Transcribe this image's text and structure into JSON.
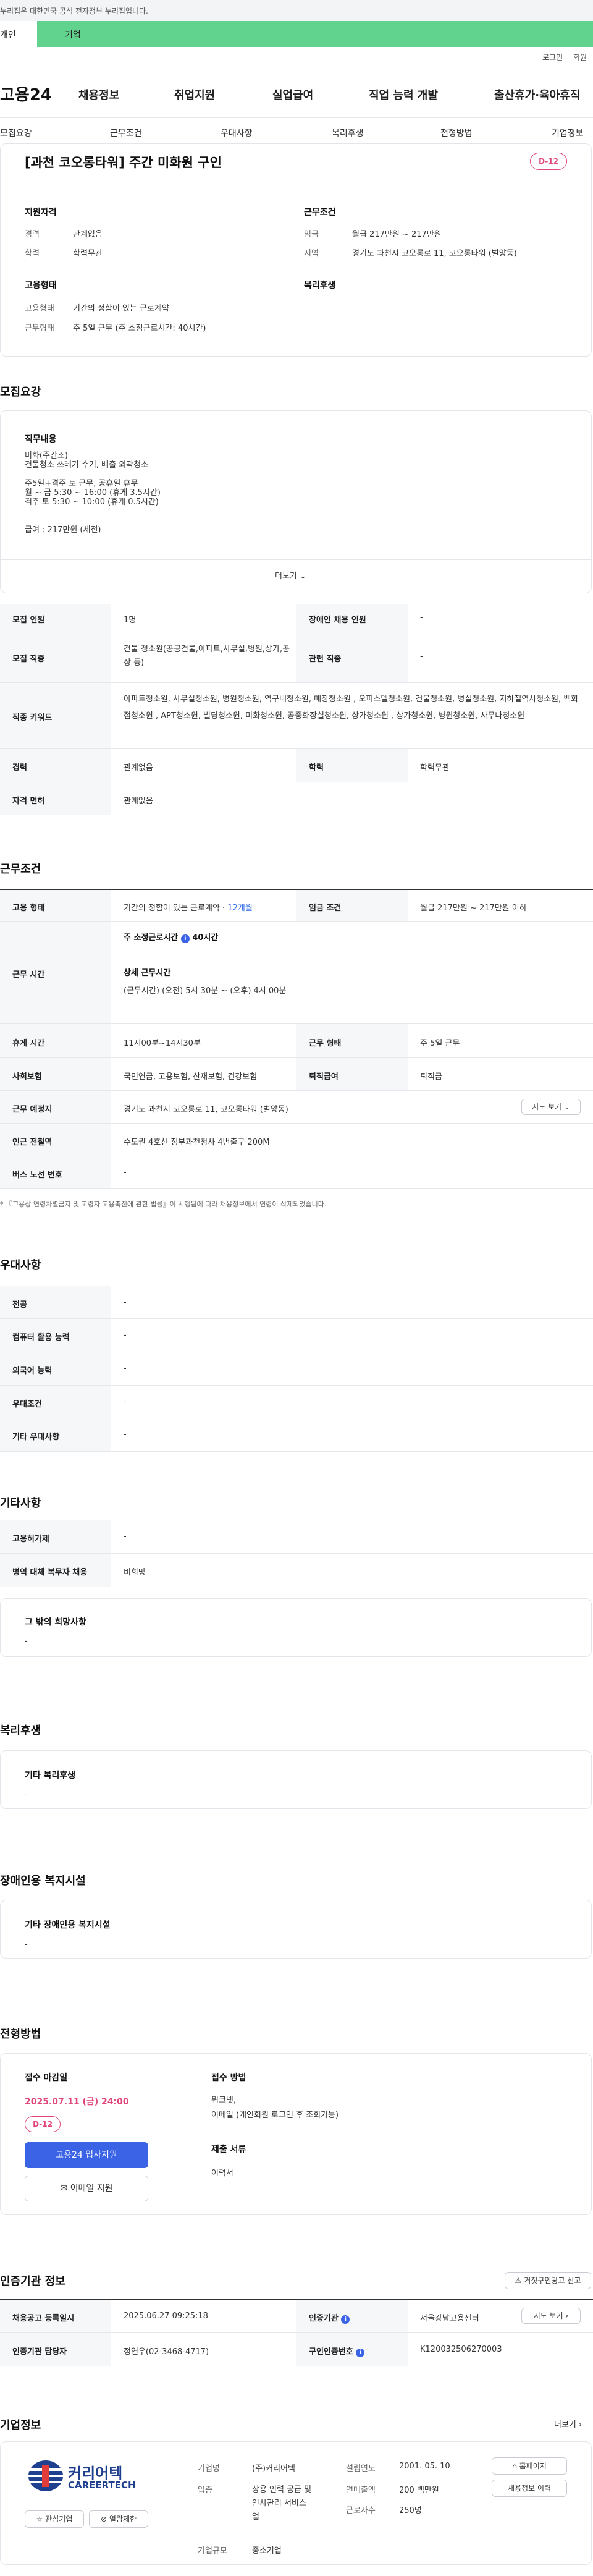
{
  "notice": {
    "text": "누리집은 대한민국 공식 전자정부 누리집입니다."
  },
  "topbar": {
    "left": "개인",
    "right": "기업"
  },
  "util": {
    "login": "로그인",
    "signup": "회원"
  },
  "logo": {
    "text": "고용24"
  },
  "gnb": [
    "채용정보",
    "취업지원",
    "실업급여",
    "직업 능력 개발",
    "출산휴가·육아휴직"
  ],
  "subtabs": [
    "모집요강",
    "근무조건",
    "우대사항",
    "복리후생",
    "전형방법",
    "기업정보"
  ],
  "job": {
    "title": "[과천 코오롱타워] 주간 미화원 구인",
    "dday": "D-12",
    "qual_heading": "지원자격",
    "career_label": "경력",
    "career_value": "관계없음",
    "edu_label": "학력",
    "edu_value": "학력무관",
    "cond_heading": "근무조건",
    "wage_label": "임금",
    "wage_value": "월급 217만원 ~ 217만원",
    "region_label": "지역",
    "region_value": "경기도 과천시 코오롱로 11, 코오롱타워 (별양동)",
    "emp_heading": "고용형태",
    "emptype_label": "고용형태",
    "emptype_value": "기간의 정함이 있는 근로계약",
    "worktype_label": "근무형태",
    "worktype_value": "주 5일 근무 (주 소정근로시간: 40시간)",
    "welfare_heading": "복리후생"
  },
  "recruit": {
    "heading": "모집요강",
    "duty_heading": "직무내용",
    "duty_lines": [
      "미화(주간조)",
      "건물청소 쓰레기 수거, 배출 외곽청소",
      "",
      "주5일+격주 토 근무, 공휴일 휴무",
      "월 ~ 금 5:30 ~ 16:00 (휴게 3.5시간)",
      "격주 토 5:30 ~ 10:00 (휴게 0.5시간)",
      "",
      "",
      "급여 : 217만원 (세전)"
    ],
    "more": "더보기",
    "rows": [
      {
        "th": "모집 인원",
        "td": "1명",
        "th2": "장애인 채용 인원",
        "td2": "-"
      },
      {
        "th": "모집 직종",
        "td": "건물 청소원(공공건물,아파트,사무실,병원,상가,공장 등)",
        "th2": "관련 직종",
        "td2": "-"
      },
      {
        "th": "직종 키워드",
        "td": "아파트청소원, 사무실청소원, 병원청소원, 역구내청소원, 매장청소원 , 오피스텔청소원, 건물청소원, 병실청소원, 지하철역사청소원, 백화점청소원 , APT청소원, 빌딩청소원, 미화청소원, 공중화장실청소원, 상가청소원 , 상가청소원, 병원청소원, 사무나청소원"
      },
      {
        "th": "경력",
        "td": "관계없음",
        "th2": "학력",
        "td2": "학력무관"
      },
      {
        "th": "자격 면허",
        "td": "관계없음"
      }
    ]
  },
  "workcond": {
    "heading": "근무조건",
    "emptype_th": "고용 형태",
    "emptype_td": "기간의 정함이 있는 근로계약 ·",
    "emptype_months": "12개월",
    "wage_th": "임금 조건",
    "wage_td": "월급 217만원 ~ 217만원 이하",
    "hours_th": "근무 시간",
    "hours_weekly_label": "주 소정근로시간",
    "hours_weekly_value": "40시간",
    "hours_detail_label": "상세 근무시간",
    "hours_detail_value": "(근무시간) (오전) 5시 30분 ~ (오후) 4시 00분",
    "rest_th": "휴게 시간",
    "rest_td": "11시00분~14시30분",
    "worktype_th": "근무 형태",
    "worktype_td": "주 5일 근무",
    "insurance_th": "사회보험",
    "insurance_td": "국민연금, 고용보험, 산재보험, 건강보험",
    "retire_th": "퇴직급여",
    "retire_td": "퇴직금",
    "place_th": "근무 예정지",
    "place_td": "경기도 과천시 코오롱로 11, 코오롱타워 (별양동)",
    "map_btn": "지도 보기",
    "station_th": "인근 전철역",
    "station_td": "수도권 4호선 정부과천청사 4번출구 200M",
    "bus_th": "버스 노선 번호",
    "bus_td": "-",
    "footnote": "* 『고용상 연령차별금지 및 고령자 고용촉진에 관한 법률』이 시행됨에 따라 채용정보에서 연령이 삭제되었습니다."
  },
  "pref": {
    "heading": "우대사항",
    "rows": [
      {
        "th": "전공",
        "td": "-"
      },
      {
        "th": "컴퓨터 활용 능력",
        "td": "-"
      },
      {
        "th": "외국어 능력",
        "td": "-"
      },
      {
        "th": "우대조건",
        "td": "-"
      },
      {
        "th": "기타 우대사항",
        "td": "-"
      }
    ]
  },
  "etc": {
    "heading": "기타사항",
    "rows": [
      {
        "th": "고용허가제",
        "td": "-"
      },
      {
        "th": "병역 대체 복무자 채용",
        "td": "비희망"
      }
    ],
    "box_title": "그 밖의 희망사항",
    "box_value": "-"
  },
  "welfare": {
    "heading": "복리후생",
    "box_title": "기타 복리후생",
    "box_value": "-"
  },
  "disabled": {
    "heading": "장애인용 복지시설",
    "box_title": "기타 장애인용 복지시설",
    "box_value": "-"
  },
  "process": {
    "heading": "전형방법",
    "deadline_label": "접수 마감일",
    "deadline_value": "2025.07.11 (금) 24:00",
    "dday": "D-12",
    "apply_btn": "고용24 입사지원",
    "email_btn": "이메일 지원",
    "method_label": "접수 방법",
    "method_lines": [
      "워크넷,",
      "이메일 (개인회원 로그인 후 조회가능)"
    ],
    "docs_label": "제출 서류",
    "docs_value": "이력서"
  },
  "cert": {
    "heading": "인증기관 정보",
    "report_btn": "거짓구인광고 신고",
    "reg_th": "채용공고 등록일시",
    "reg_td": "2025.06.27 09:25:18",
    "org_th": "인증기관",
    "org_td": "서울강남고용센터",
    "org_btn": "지도 보기",
    "mgr_th": "인증기관 담당자",
    "mgr_td": "정연우(02-3468-4717)",
    "num_th": "구인인증번호",
    "num_td": "K120032506270003"
  },
  "company": {
    "heading": "기업정보",
    "more": "더보기",
    "logo_kr": "커리어텍",
    "logo_en": "CAREERTECH",
    "fav_btn": "관심기업",
    "block_btn": "열람제한",
    "name_label": "기업명",
    "name_value": "(주)커리어텍",
    "found_label": "설립연도",
    "found_value": "2001. 05. 10",
    "biz_label": "업종",
    "biz_lines": [
      "상용 인력 공급 및",
      "인사관리 서비스",
      "업"
    ],
    "sales_label": "연매출액",
    "sales_value": "200 백만원",
    "emp_label": "근로자수",
    "emp_value": "250명",
    "size_label": "기업규모",
    "size_value": "중소기업",
    "home_btn": "홈페이지",
    "jobs_btn": "채용정보 이력"
  },
  "colors": {
    "accent": "#62d28f",
    "primary": "#3b63e6",
    "pink": "#e0467c"
  }
}
